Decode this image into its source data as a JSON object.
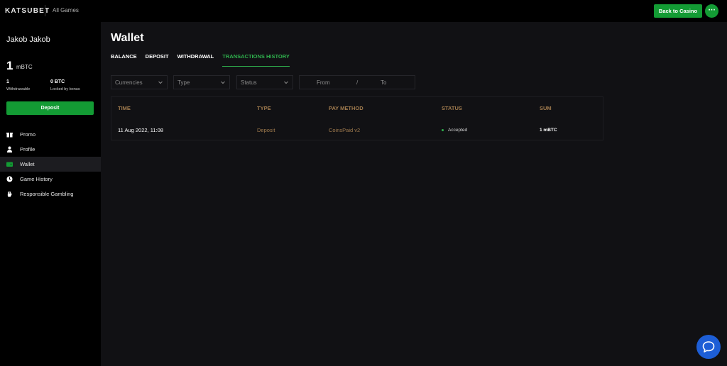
{
  "header": {
    "logo_text": "KATSUBET",
    "all_games_label": "All Games",
    "back_to_casino_label": "Back to Casino",
    "more_label": "···"
  },
  "sidebar": {
    "user_name": "Jakob Jakob",
    "balance_value": "1",
    "balance_unit": "mBTC",
    "withdrawable_value": "1",
    "withdrawable_label": "Withdrawable",
    "locked_value": "0 BTC",
    "locked_label": "Locked by bonus",
    "deposit_label": "Deposit",
    "nav": [
      {
        "label": "Promo",
        "icon": "gift-icon"
      },
      {
        "label": "Profile",
        "icon": "user-icon"
      },
      {
        "label": "Wallet",
        "icon": "wallet-icon",
        "active": true
      },
      {
        "label": "Game History",
        "icon": "clock-icon"
      },
      {
        "label": "Responsible Gambling",
        "icon": "hand-icon"
      }
    ]
  },
  "main": {
    "title": "Wallet",
    "tabs": [
      {
        "label": "BALANCE"
      },
      {
        "label": "DEPOSIT"
      },
      {
        "label": "WITHDRAWAL"
      },
      {
        "label": "TRANSACTIONS HISTORY",
        "active": true
      }
    ],
    "filters": {
      "currencies": "Currencies",
      "type": "Type",
      "status": "Status",
      "from_placeholder": "From",
      "separator": "/",
      "to_placeholder": "To"
    },
    "table": {
      "columns": [
        "TIME",
        "TYPE",
        "PAY METHOD",
        "STATUS",
        "SUM"
      ],
      "rows": [
        {
          "time": "11 Aug 2022, 11:08",
          "type": "Deposit",
          "method": "CoinsPaid v2",
          "status": "Accepted",
          "sum": "1 mBTC"
        }
      ]
    }
  },
  "colors": {
    "accent_green": "#139b34",
    "column_header": "#a07b4e",
    "chat_blue": "#1d5ed6"
  }
}
